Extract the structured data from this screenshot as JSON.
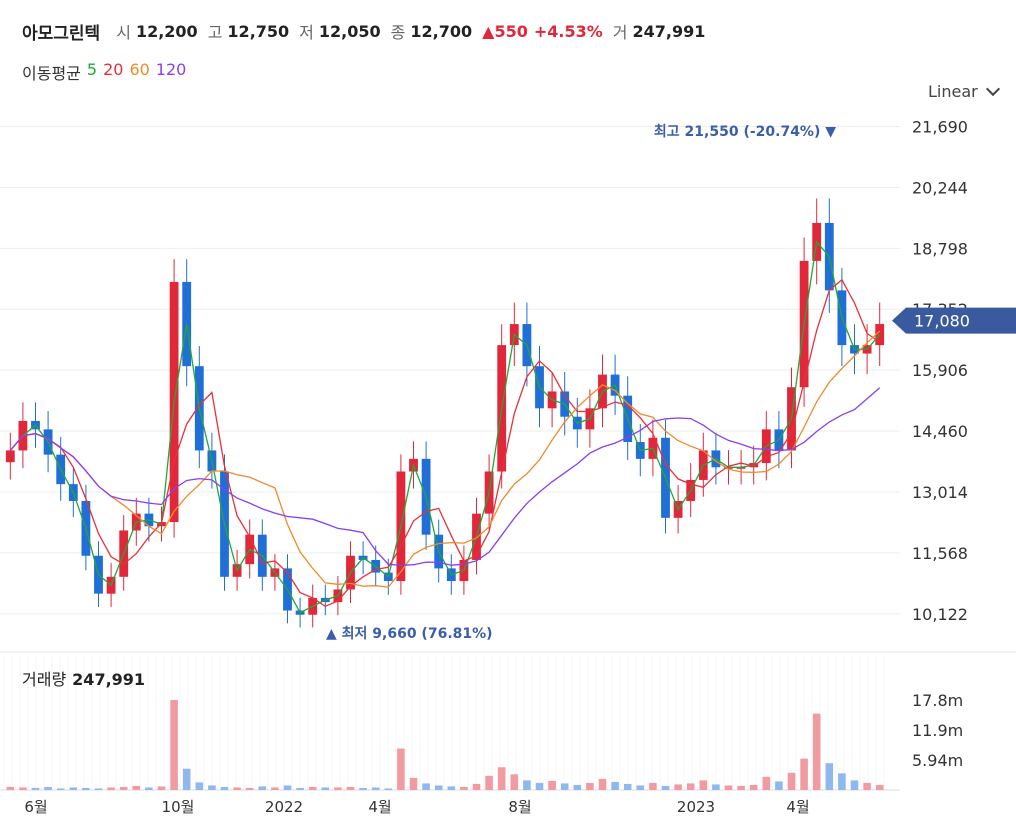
{
  "header": {
    "name": "아모그린텍",
    "open_label": "시",
    "open": "12,200",
    "high_label": "고",
    "high": "12,750",
    "low_label": "저",
    "low": "12,050",
    "close_label": "종",
    "close": "12,700",
    "change": "▲550",
    "change_pct": "+4.53%",
    "volume_label": "거",
    "volume": "247,991"
  },
  "ma_legend": {
    "label": "이동평균",
    "items": [
      {
        "label": "5",
        "color": "#22a838"
      },
      {
        "label": "20",
        "color": "#e8303c"
      },
      {
        "label": "60",
        "color": "#f08a2a"
      },
      {
        "label": "120",
        "color": "#8a3ff0"
      }
    ]
  },
  "scale_selector": "Linear",
  "volume_panel": {
    "label": "거래량",
    "value": "247,991"
  },
  "colors": {
    "up": "#e0283a",
    "down": "#1f6fd6",
    "grid": "#eeeeee",
    "tag": "#3a5aa0",
    "marker": "#3b5ea8"
  },
  "chart_data": {
    "type": "candlestick",
    "price_axis": {
      "ticks": [
        "21,690",
        "20,244",
        "18,798",
        "17,352",
        "15,906",
        "14,460",
        "13,014",
        "11,568",
        "10,122"
      ],
      "ylim": [
        9500,
        22200
      ]
    },
    "volume_axis": {
      "ticks": [
        "17.8m",
        "11.9m",
        "5.94m"
      ]
    },
    "x_labels": [
      "6월",
      "10월",
      "2022",
      "4월",
      "8월",
      "2023",
      "4월"
    ],
    "current_price": "17,080",
    "high_marker": {
      "label": "최고",
      "value": "21,550 (-20.74%)"
    },
    "low_marker": {
      "label": "최저",
      "value": "9,660 (76.81%)"
    },
    "close_series": [
      14000,
      14700,
      14500,
      13900,
      13200,
      12800,
      11500,
      10600,
      11000,
      12100,
      12500,
      12200,
      12300,
      18000,
      16000,
      14000,
      13500,
      11000,
      11300,
      12000,
      11000,
      11200,
      10200,
      10100,
      10500,
      10400,
      10700,
      11500,
      11400,
      11100,
      10900,
      13500,
      13800,
      12000,
      11200,
      10900,
      11400,
      12500,
      13500,
      16500,
      17000,
      16000,
      15000,
      15400,
      14800,
      14500,
      15000,
      15800,
      15300,
      14200,
      13800,
      14300,
      12400,
      12800,
      13300,
      14000,
      13600,
      13600,
      13600,
      13700,
      14500,
      14000,
      15500,
      18500,
      19400,
      17800,
      16500,
      16300,
      16500,
      17000
    ],
    "volume_series": [
      0.6,
      0.5,
      0.4,
      0.6,
      0.3,
      0.5,
      0.4,
      0.3,
      0.5,
      0.6,
      0.8,
      0.5,
      0.7,
      17.8,
      4.2,
      1.5,
      0.9,
      0.6,
      0.5,
      0.4,
      0.7,
      0.5,
      0.9,
      0.4,
      0.6,
      0.5,
      0.5,
      0.6,
      0.4,
      0.5,
      0.3,
      8.2,
      2.4,
      1.3,
      0.9,
      0.7,
      0.6,
      1.2,
      2.8,
      4.5,
      3.1,
      1.9,
      1.4,
      1.8,
      1.3,
      1.0,
      1.4,
      2.2,
      1.6,
      1.2,
      0.9,
      1.4,
      0.8,
      1.1,
      1.3,
      1.9,
      1.1,
      0.9,
      0.8,
      1.0,
      2.6,
      1.7,
      3.4,
      6.2,
      15.1,
      5.3,
      3.3,
      1.9,
      1.4,
      1.0
    ]
  }
}
